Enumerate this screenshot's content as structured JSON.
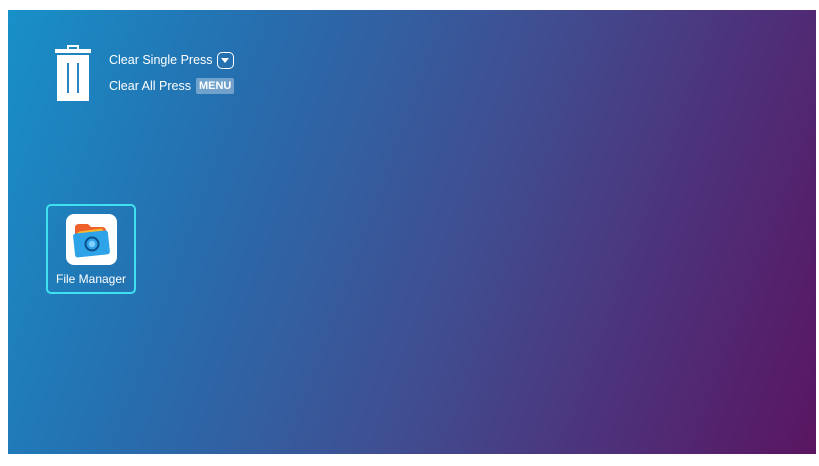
{
  "hints": {
    "clear_single": "Clear Single Press",
    "clear_all": "Clear All Press",
    "menu_key": "MENU",
    "down_key_icon": "down-arrow-key-icon"
  },
  "apps": [
    {
      "label": "File Manager",
      "icon": "file-manager-icon",
      "focused": true
    }
  ],
  "colors": {
    "gradient_start": "#1890c8",
    "gradient_end": "#5a1560",
    "focus_border": "#3fe0f0"
  }
}
